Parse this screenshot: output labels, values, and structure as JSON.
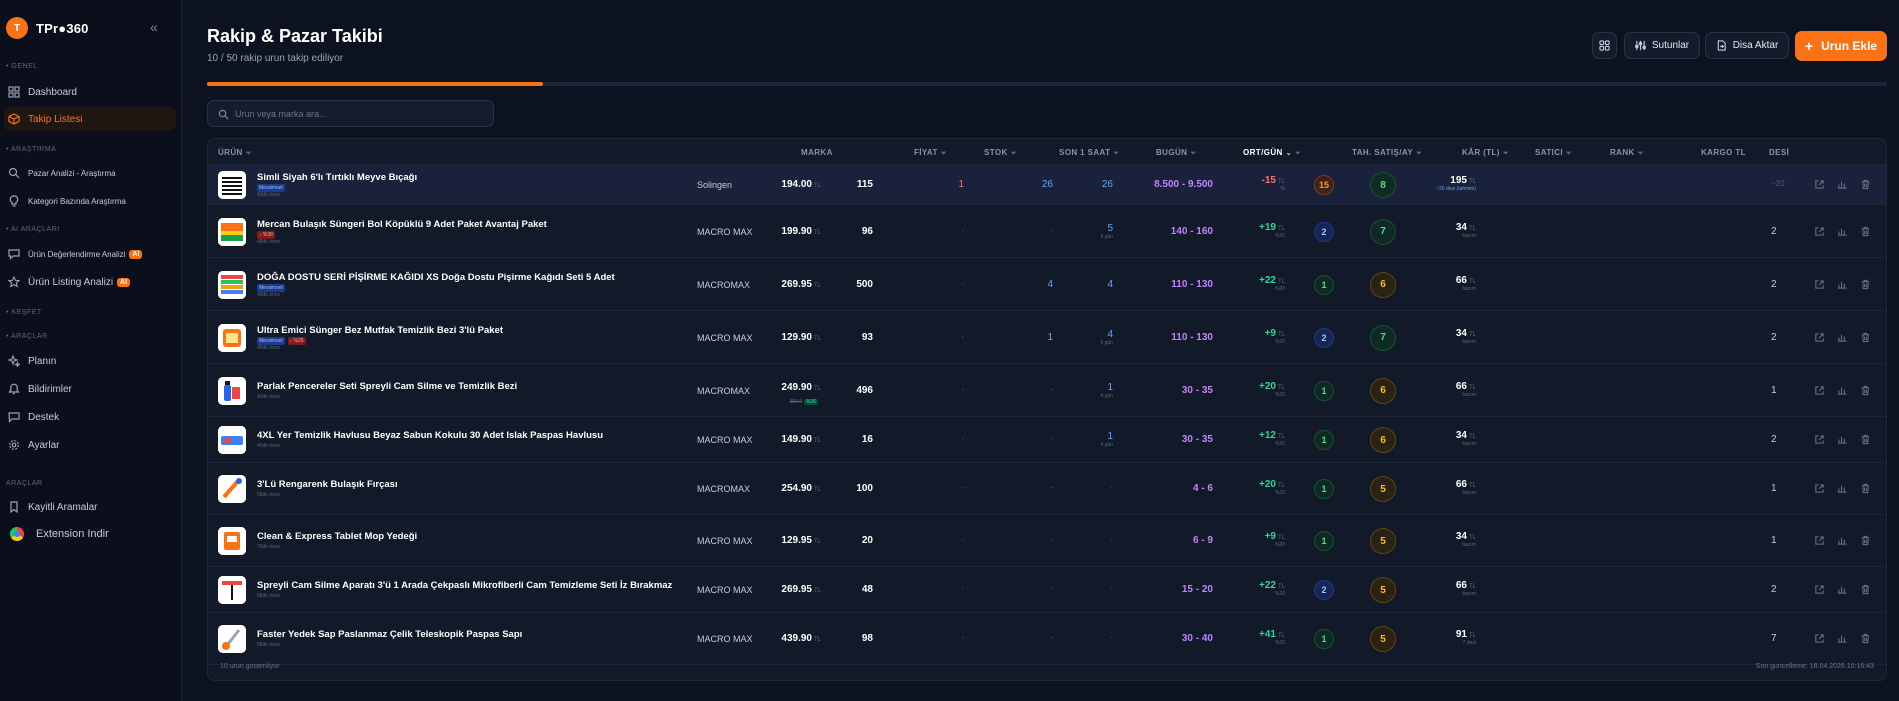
{
  "app": {
    "logo_letter": "T",
    "name": "TPr●360"
  },
  "sidebar": {
    "sections": [
      "GENEL",
      "ARAŞTIRMA",
      "AI ARAÇLARI",
      "KEŞFET",
      "ARAÇLAR",
      "ARAÇLAR"
    ],
    "items": [
      {
        "label": "Dashboard",
        "icon": "dashboard-icon"
      },
      {
        "label": "Takip Listesi",
        "icon": "package-icon",
        "active": true
      },
      {
        "label": "Pazar Analizi - Araştırma",
        "icon": "search-icon"
      },
      {
        "label": "Kategori Bazında Araştırma",
        "icon": "bulb-icon"
      },
      {
        "label": "Ürün Değerlendirme Analizi",
        "icon": "message-icon",
        "badge": "AI"
      },
      {
        "label": "Ürün Listing Analizi",
        "icon": "star-icon",
        "badge": "AI"
      },
      {
        "label": "Planın",
        "icon": "sparkle-icon"
      },
      {
        "label": "Bildirimler",
        "icon": "bell-icon"
      },
      {
        "label": "Destek",
        "icon": "chat-icon"
      },
      {
        "label": "Ayarlar",
        "icon": "gear-icon"
      },
      {
        "label": "Kayitli Aramalar",
        "icon": "bookmark-icon"
      },
      {
        "label": "Extension Indir",
        "icon": "chrome-icon"
      }
    ]
  },
  "header": {
    "title": "Rakip & Pazar Takibi",
    "subtitle": "10 / 50 rakip urun takip ediliyor",
    "buttons": {
      "columns": "Sutunlar",
      "export": "Disa Aktar",
      "add": "Urun Ekle"
    },
    "progress": 0.2
  },
  "search": {
    "placeholder": "Urun veya marka ara..."
  },
  "table": {
    "headers": {
      "urun": "ÜRÜN",
      "marka": "MARKA",
      "fiyat": "FİYAT",
      "stok": "STOK",
      "son1": "SON 1 SAAT",
      "bugun": "BUGÜN",
      "ortgun": "ORT/GÜN",
      "tahsatis": "TAH. SATIŞ/AY",
      "kar": "KÂR (TL)",
      "satici": "SATICI",
      "rank": "RANK",
      "kargo": "KARGO TL",
      "desi": "DESİ"
    },
    "rows": [
      {
        "name": "Simli Siyah 6'lı Tırtıklı Meyve Bıçağı",
        "tags": [
          {
            "t": "Mevsimsel",
            "c": "blue"
          }
        ],
        "ago": "43dk önce",
        "thumb": "knife",
        "brand": "Solingen",
        "price": "194.00",
        "old_price": "",
        "discount": "",
        "stock": "115",
        "son1": "1",
        "son1_color": "red",
        "bugun": "26",
        "ort": "26",
        "ort_sub": "",
        "sales": "8.500 - 9.500",
        "profit": "-15",
        "profit_sub": "%",
        "seller": "15",
        "seller_color": "orange",
        "rank": "8",
        "rank_color": "green",
        "cargo": "195",
        "cargo_sub": "~20 desi (tahmini)",
        "cargo_sub_blue": true,
        "desi": "~20",
        "desi_muted": true
      },
      {
        "name": "Mercan Bulaşık Süngeri Bol Köpüklü 9 Adet Paket Avantaj Paket",
        "tags": [
          {
            "t": "↓ %38",
            "c": "red"
          }
        ],
        "ago": "48dk önce",
        "thumb": "sponge",
        "brand": "MACRO MAX",
        "price": "199.90",
        "old_price": "",
        "discount": "",
        "stock": "96",
        "son1": "-",
        "son1_color": "muted",
        "bugun": "-",
        "ort": "5",
        "ort_sub": "6 gün",
        "sales": "140 - 160",
        "profit": "+19",
        "profit_sub": "%20",
        "seller": "2",
        "seller_color": "blue",
        "rank": "7",
        "rank_color": "green",
        "cargo": "34",
        "cargo_sub": "bazım",
        "cargo_sub_blue": false,
        "desi": "2",
        "desi_muted": false
      },
      {
        "name": "DOĞA DOSTU SERİ PİŞİRME KAĞIDI XS Doğa Dostu Pişirme Kağıdı Seti 5 Adet",
        "tags": [
          {
            "t": "Mevsimsel",
            "c": "blue"
          }
        ],
        "ago": "48dk önce",
        "thumb": "paper",
        "brand": "MACROMAX",
        "price": "269.95",
        "old_price": "",
        "discount": "",
        "stock": "500",
        "son1": "-",
        "son1_color": "muted",
        "bugun": "4",
        "ort": "4",
        "ort_sub": "",
        "sales": "110 - 130",
        "profit": "+22",
        "profit_sub": "%20",
        "seller": "1",
        "seller_color": "green",
        "rank": "6",
        "rank_color": "amber",
        "cargo": "66",
        "cargo_sub": "bazım",
        "cargo_sub_blue": false,
        "desi": "2",
        "desi_muted": false
      },
      {
        "name": "Ultra Emici Sünger Bez Mutfak Temizlik Bezi 3'lü Paket",
        "tags": [
          {
            "t": "Mevsimsel",
            "c": "blue"
          },
          {
            "t": "↓ %26",
            "c": "red"
          }
        ],
        "ago": "48dk önce",
        "thumb": "cloth",
        "brand": "MACRO MAX",
        "price": "129.90",
        "old_price": "",
        "discount": "",
        "stock": "93",
        "son1": "-",
        "son1_color": "muted",
        "bugun": "1",
        "ort": "4",
        "ort_sub": "6 gün",
        "sales": "110 - 130",
        "profit": "+9",
        "profit_sub": "%20",
        "seller": "2",
        "seller_color": "blue",
        "rank": "7",
        "rank_color": "green",
        "cargo": "34",
        "cargo_sub": "bazım",
        "cargo_sub_blue": false,
        "desi": "2",
        "desi_muted": false
      },
      {
        "name": "Parlak Pencereler Seti Spreyli Cam Silme ve Temizlik Bezi",
        "tags": [],
        "ago": "43dk önce",
        "thumb": "spray",
        "brand": "MACROMAX",
        "price": "249.90",
        "old_price": "389.0",
        "discount": "%36",
        "stock": "496",
        "son1": "-",
        "son1_color": "muted",
        "bugun": "-",
        "ort": "1",
        "ort_sub": "4 gün",
        "sales": "30 - 35",
        "profit": "+20",
        "profit_sub": "%20",
        "seller": "1",
        "seller_color": "green",
        "rank": "6",
        "rank_color": "amber",
        "cargo": "66",
        "cargo_sub": "bazım",
        "cargo_sub_blue": false,
        "desi": "1",
        "desi_muted": false
      },
      {
        "name": "4XL Yer Temizlik Havlusu Beyaz Sabun Kokulu 30 Adet Islak Paspas Havlusu",
        "tags": [],
        "ago": "45dk önce",
        "thumb": "towel",
        "brand": "MACRO MAX",
        "price": "149.90",
        "old_price": "",
        "discount": "",
        "stock": "16",
        "son1": "-",
        "son1_color": "muted",
        "bugun": "-",
        "ort": "1",
        "ort_sub": "4 gün",
        "sales": "30 - 35",
        "profit": "+12",
        "profit_sub": "%20",
        "seller": "1",
        "seller_color": "green",
        "rank": "6",
        "rank_color": "amber",
        "cargo": "34",
        "cargo_sub": "bazım",
        "cargo_sub_blue": false,
        "desi": "2",
        "desi_muted": false
      },
      {
        "name": "3'Lü Rengarenk Bulaşık Fırçası",
        "tags": [],
        "ago": "58dk önce",
        "thumb": "brush",
        "brand": "MACROMAX",
        "price": "254.90",
        "old_price": "",
        "discount": "",
        "stock": "100",
        "son1": "-",
        "son1_color": "muted",
        "bugun": "-",
        "ort": "-",
        "ort_sub": "",
        "sales": "4 - 6",
        "profit": "+20",
        "profit_sub": "%20",
        "seller": "1",
        "seller_color": "green",
        "rank": "5",
        "rank_color": "amber",
        "cargo": "66",
        "cargo_sub": "bazım",
        "cargo_sub_blue": false,
        "desi": "1",
        "desi_muted": false
      },
      {
        "name": "Clean & Express Tablet Mop Yedeği",
        "tags": [],
        "ago": "70dk önce",
        "thumb": "mop",
        "brand": "MACRO MAX",
        "price": "129.95",
        "old_price": "",
        "discount": "",
        "stock": "20",
        "son1": "-",
        "son1_color": "muted",
        "bugun": "-",
        "ort": "-",
        "ort_sub": "",
        "sales": "6 - 9",
        "profit": "+9",
        "profit_sub": "%20",
        "seller": "1",
        "seller_color": "green",
        "rank": "5",
        "rank_color": "amber",
        "cargo": "34",
        "cargo_sub": "bazım",
        "cargo_sub_blue": false,
        "desi": "1",
        "desi_muted": false
      },
      {
        "name": "Spreyli Cam Silme Aparatı 3'ü 1 Arada Çekpaslı Mikrofiberli Cam Temizleme Seti İz Bırakmaz",
        "tags": [],
        "ago": "58dk önce",
        "thumb": "wiper",
        "brand": "MACRO MAX",
        "price": "269.95",
        "old_price": "",
        "discount": "",
        "stock": "48",
        "son1": "-",
        "son1_color": "muted",
        "bugun": "-",
        "ort": "-",
        "ort_sub": "",
        "sales": "15 - 20",
        "profit": "+22",
        "profit_sub": "%20",
        "seller": "2",
        "seller_color": "blue",
        "rank": "5",
        "rank_color": "amber",
        "cargo": "66",
        "cargo_sub": "bazım",
        "cargo_sub_blue": false,
        "desi": "2",
        "desi_muted": false
      },
      {
        "name": "Faster Yedek Sap Paslanmaz Çelik Teleskopik Paspas Sapı",
        "tags": [],
        "ago": "68dk önce",
        "thumb": "pole",
        "brand": "MACRO MAX",
        "price": "439.90",
        "old_price": "",
        "discount": "",
        "stock": "98",
        "son1": "-",
        "son1_color": "muted",
        "bugun": "-",
        "ort": "-",
        "ort_sub": "",
        "sales": "30 - 40",
        "profit": "+41",
        "profit_sub": "%20",
        "seller": "1",
        "seller_color": "green",
        "rank": "5",
        "rank_color": "amber",
        "cargo": "91",
        "cargo_sub": "7 desi",
        "cargo_sub_blue": false,
        "desi": "7",
        "desi_muted": false
      }
    ],
    "tl": "TL",
    "footer_left": "10 urun gosteriliyor",
    "footer_right": "Son guncelleme: 18.04.2026 10:16:43"
  },
  "colors": {
    "accent": "#f97316",
    "background": "#0c1220",
    "panel": "#121a2a",
    "green": "#34d399",
    "red": "#f87171",
    "blue": "#60a5fa",
    "purple": "#c084fc"
  }
}
